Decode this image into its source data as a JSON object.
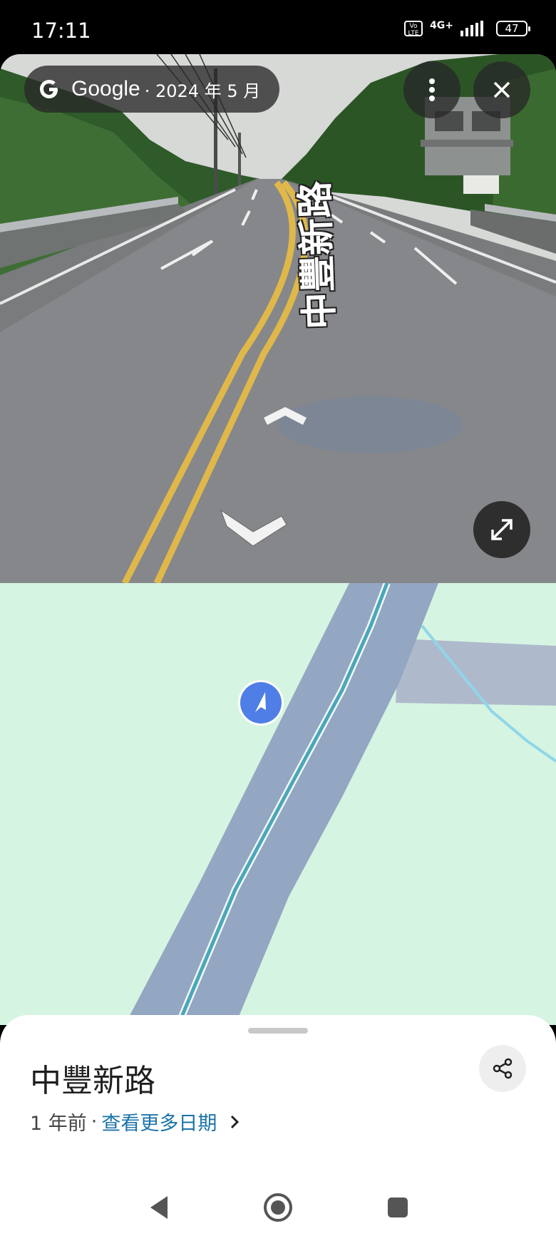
{
  "status_bar": {
    "time": "17:11",
    "volte_label": "Vo LTE",
    "network": "4G+",
    "battery": "47"
  },
  "street_view": {
    "brand": "Google",
    "date": "· 2024 年 5 月",
    "road_label": "中豐新路",
    "icons": [
      "google-g-icon",
      "more-vert-icon",
      "close-icon",
      "fullscreen-icon",
      "move-forward-arrow",
      "move-back-arrow"
    ]
  },
  "map": {
    "icons": [
      "location-arrow-icon"
    ],
    "colors": {
      "land": "#d6f4e2",
      "road": "#93a6c2",
      "water": "#8fd6e8"
    }
  },
  "place": {
    "title": "中豐新路",
    "age": "1 年前",
    "separator": "·",
    "more_dates_link": "查看更多日期"
  },
  "nav": {
    "icons": [
      "back-triangle-icon",
      "home-circle-icon",
      "recents-square-icon"
    ]
  },
  "colors": {
    "accent_link": "#1a73a8",
    "map_pin": "#4f7fe6"
  }
}
